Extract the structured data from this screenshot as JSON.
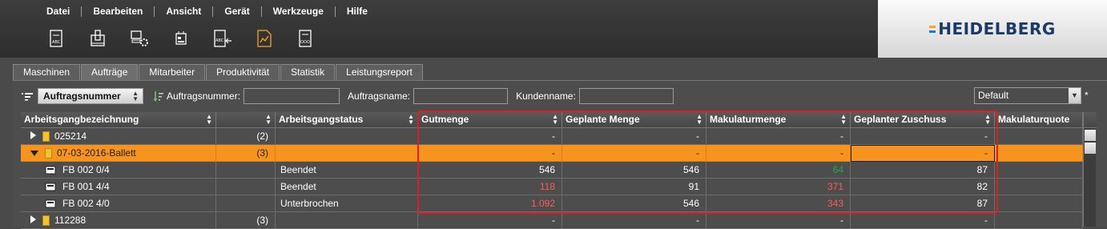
{
  "menu": [
    "Datei",
    "Bearbeiten",
    "Ansicht",
    "Gerät",
    "Werkzeuge",
    "Hilfe"
  ],
  "toolbar_icons": [
    "text-document-icon",
    "printer-columns-icon",
    "computer-settings-icon",
    "device-settings-icon",
    "text-export-icon",
    "chart-document-icon",
    "document-ooo-icon"
  ],
  "brand": {
    "text": "HEIDELBERG"
  },
  "tabs": [
    "Maschinen",
    "Aufträge",
    "Mitarbeiter",
    "Produktivität",
    "Statistik",
    "Leistungsreport"
  ],
  "filter": {
    "sort_value": "Auftragsnummer",
    "label_order_no": "Auftragsnummer:",
    "label_order_name": "Auftragsname:",
    "label_customer": "Kundenname:",
    "order_no_value": "",
    "order_name_value": "",
    "customer_value": "",
    "view_select": "Default",
    "asterisk": "*"
  },
  "columns": [
    "Arbeitsgangbezeichnung",
    "",
    "Arbeitsgangstatus",
    "Gutmenge",
    "Geplante Menge",
    "Makulaturmenge",
    "Geplanter Zuschuss",
    "Makulaturquote"
  ],
  "rows": [
    {
      "name": "025214",
      "count": "(2)",
      "status": "",
      "gut": "-",
      "geplant": "-",
      "makulatur": "-",
      "zuschuss": "-",
      "quote": ""
    },
    {
      "name": "07-03-2016-Ballett",
      "count": "(3)",
      "status": "",
      "gut": "-",
      "geplant": "-",
      "makulatur": "-",
      "zuschuss": "-",
      "quote": ""
    },
    {
      "name": "FB 002  0/4",
      "count": "",
      "status": "Beendet",
      "gut": "546",
      "geplant": "546",
      "makulatur": "64",
      "zuschuss": "87",
      "quote": ""
    },
    {
      "name": "FB 001  4/4",
      "count": "",
      "status": "Beendet",
      "gut": "118",
      "geplant": "91",
      "makulatur": "371",
      "zuschuss": "82",
      "quote": ""
    },
    {
      "name": "FB 002  4/0",
      "count": "",
      "status": "Unterbrochen",
      "gut": "1.092",
      "geplant": "546",
      "makulatur": "343",
      "zuschuss": "87",
      "quote": ""
    },
    {
      "name": "112288",
      "count": "(3)",
      "status": "",
      "gut": "-",
      "geplant": "-",
      "makulatur": "-",
      "zuschuss": "-",
      "quote": ""
    }
  ],
  "colors": {
    "highlight_row": "#f7941d",
    "warning_value": "#ff5a5a",
    "good_value": "#22aa44",
    "annotation_box": "#e51b24"
  }
}
